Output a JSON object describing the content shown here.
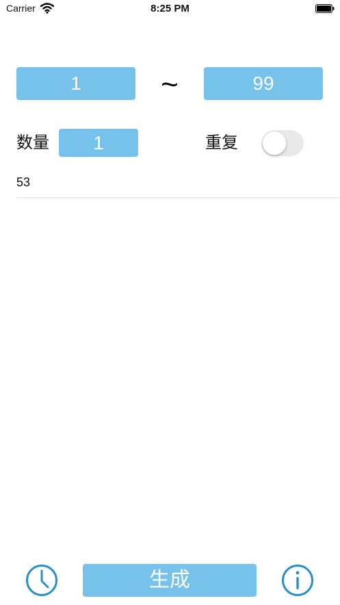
{
  "status_bar": {
    "carrier": "Carrier",
    "time": "8:25 PM"
  },
  "range": {
    "min": "1",
    "separator": "~",
    "max": "99"
  },
  "count": {
    "label": "数量",
    "value": "1"
  },
  "repeat": {
    "label": "重复",
    "enabled": false
  },
  "result": {
    "value": "53"
  },
  "footer": {
    "generate_label": "生成"
  },
  "colors": {
    "accent": "#76c2ea",
    "icon": "#2a8fc7"
  }
}
